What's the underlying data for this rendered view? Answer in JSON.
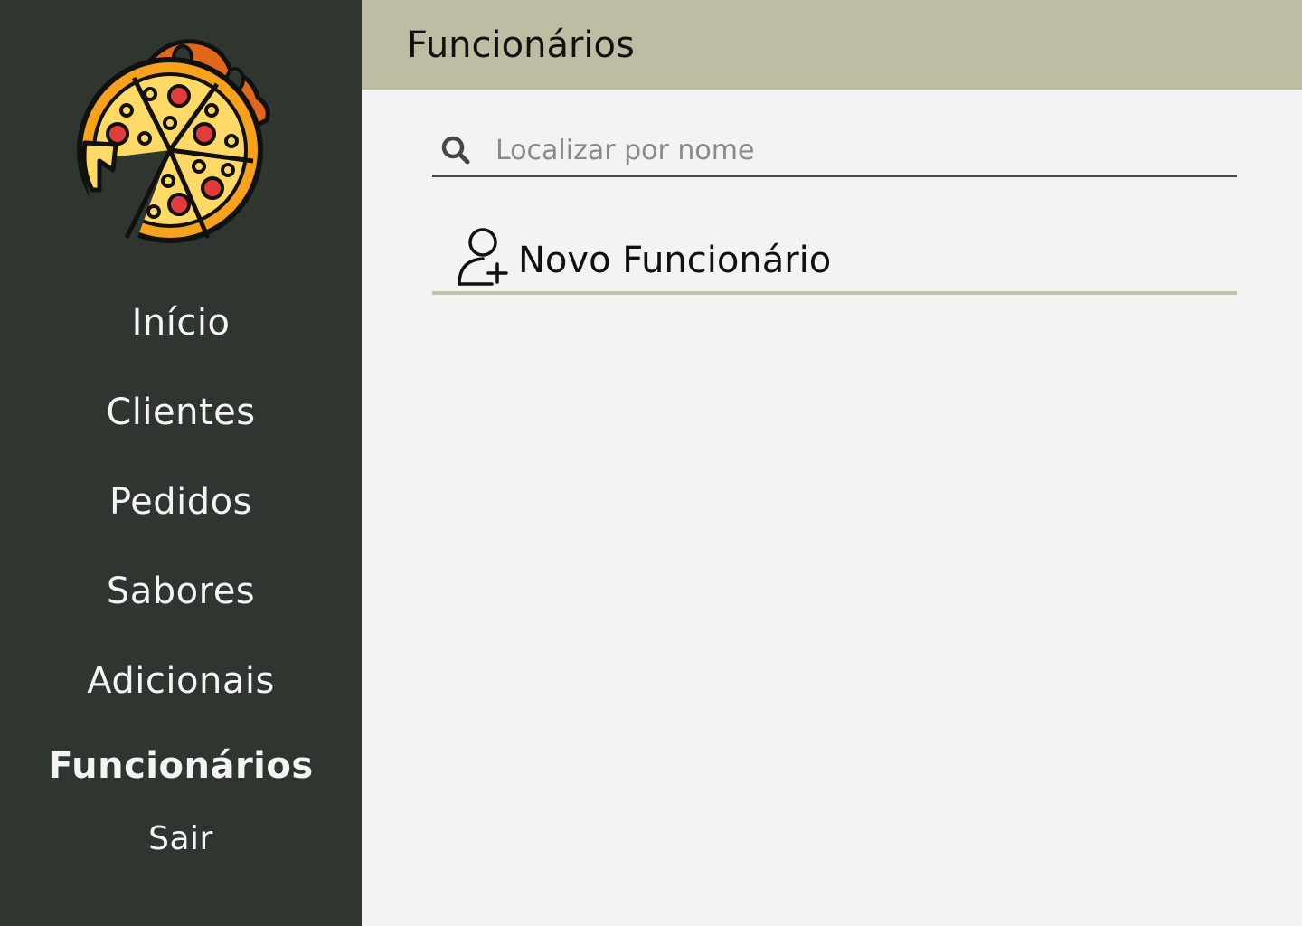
{
  "app": {
    "colors": {
      "sidebar": "#2e362f",
      "header": "#bebca3",
      "content": "#f3f3f3",
      "divider": "#c4c2a6"
    }
  },
  "sidebar": {
    "logo_icon": "pizza-icon",
    "items": [
      {
        "label": "Início"
      },
      {
        "label": "Clientes"
      },
      {
        "label": "Pedidos"
      },
      {
        "label": "Sabores"
      },
      {
        "label": "Adicionais"
      },
      {
        "label": "Funcionários",
        "active": true
      }
    ],
    "logout_label": "Sair"
  },
  "header": {
    "title": "Funcionários"
  },
  "search": {
    "icon": "search-icon",
    "placeholder": "Localizar por nome",
    "value": ""
  },
  "new_employee": {
    "icon": "add-user-icon",
    "label": "Novo Funcionário"
  }
}
